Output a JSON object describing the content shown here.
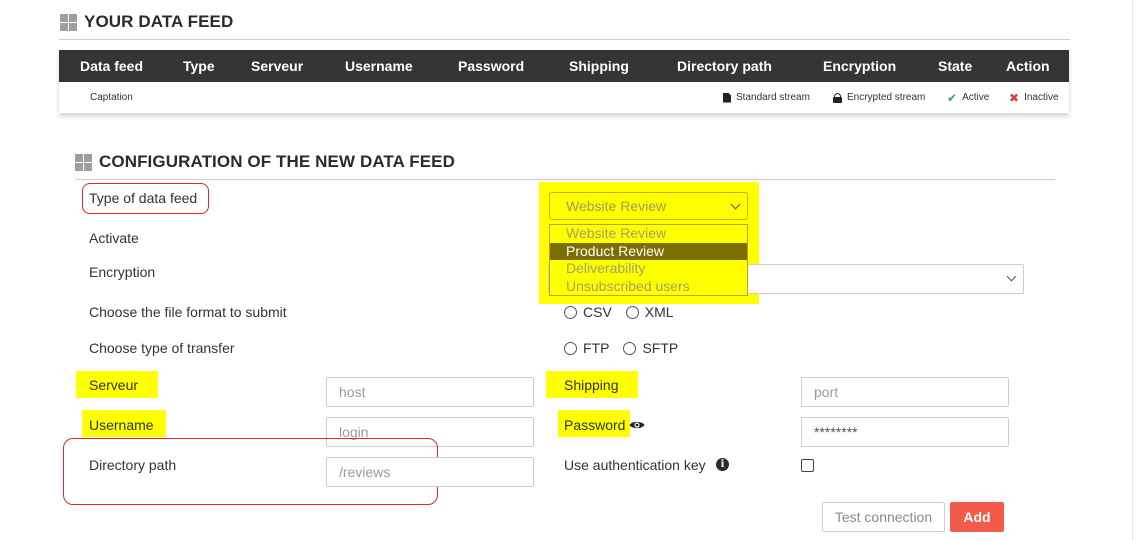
{
  "feed_section": {
    "title": "YOUR DATA FEED",
    "columns": [
      "Data feed",
      "Type",
      "Serveur",
      "Username",
      "Password",
      "Shipping",
      "Directory path",
      "Encryption",
      "State",
      "Action"
    ],
    "row": {
      "data_feed": "Captation"
    },
    "legend": {
      "standard_stream": "Standard stream",
      "encrypted_stream": "Encrypted stream",
      "active": "Active",
      "inactive": "Inactive"
    }
  },
  "config_section": {
    "title": "CONFIGURATION OF THE NEW DATA FEED",
    "labels": {
      "type_of_feed": "Type of data feed",
      "activate": "Activate",
      "encryption": "Encryption",
      "file_format": "Choose the file format to submit",
      "transfer_type": "Choose type of transfer",
      "serveur": "Serveur",
      "username": "Username",
      "directory_path": "Directory path",
      "shipping": "Shipping",
      "password": "Password",
      "auth_key": "Use authentication key"
    },
    "type_select": {
      "value": "Website Review",
      "options": [
        "Website Review",
        "Product Review",
        "Deliverability",
        "Unsubscribed users"
      ],
      "selected_option": "Product Review"
    },
    "file_format_options": [
      "CSV",
      "XML"
    ],
    "transfer_options": [
      "FTP",
      "SFTP"
    ],
    "inputs": {
      "host_placeholder": "host",
      "login_placeholder": "login",
      "directory_value": "/reviews",
      "port_placeholder": "port",
      "password_value": "********"
    },
    "buttons": {
      "test_connection": "Test connection",
      "add": "Add"
    }
  },
  "colors": {
    "header_bg": "#353535",
    "highlight": "#ffff00",
    "annotation_red": "#e8232b",
    "add_button": "#f35a4a",
    "active_green": "#3aa577",
    "inactive_red": "#e03b3b"
  }
}
